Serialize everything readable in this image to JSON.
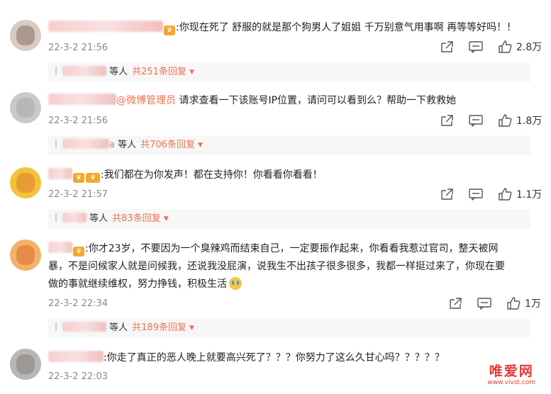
{
  "comments": [
    {
      "text": ":你现在死了 舒服的就是那个狗男人了姐姐 千万别意气用事啊 再等等好吗！！",
      "time": "22-3-2 21:56",
      "likes": "2.8万",
      "reply_who": "等人",
      "reply_count": "共251条回复"
    },
    {
      "mention": "@微博管理员",
      "text": " 请求查看一下该账号IP位置，请问可以看到么？帮助一下救救她",
      "time": "22-3-2 21:56",
      "likes": "1.8万",
      "reply_name_tail": "a",
      "reply_who": "等人",
      "reply_count": "共706条回复"
    },
    {
      "text": ":我们都在为你发声！都在支持你！你看看你看看！",
      "time": "22-3-2 21:57",
      "likes": "1.1万",
      "reply_who": "等人",
      "reply_count": "共83条回复"
    },
    {
      "text_line1": ":你才23岁，不要因为一个臭辣鸡而结束自己，一定要振作起来，你看看我惹过官司，整天被网",
      "text_line2": "暴，不是问候家人就是问候我，还说我没屁演，说我生不出孩子很多很多，我都一样挺过来了，你现在要",
      "text_line3": "做的事就继续维权，努力挣钱，积极生活",
      "time": "22-3-2 22:34",
      "likes": "1万",
      "reply_who": "等人",
      "reply_count": "共189条回复"
    },
    {
      "text": ":你走了真正的恶人晚上就要高兴死了？？？你努力了这么久甘心吗？？？？？",
      "time": "22-3-2 22:03"
    }
  ],
  "watermark": {
    "title": "唯爱网",
    "url": "www.vivst.com"
  },
  "colors": {
    "accent": "#eb7350",
    "time_gray": "#8a8a8a",
    "reply_bg": "#f7f7f7",
    "watermark": "#e33a3a"
  },
  "icons": [
    "share-icon",
    "comment-icon",
    "like-icon",
    "crown-badge-icon"
  ]
}
